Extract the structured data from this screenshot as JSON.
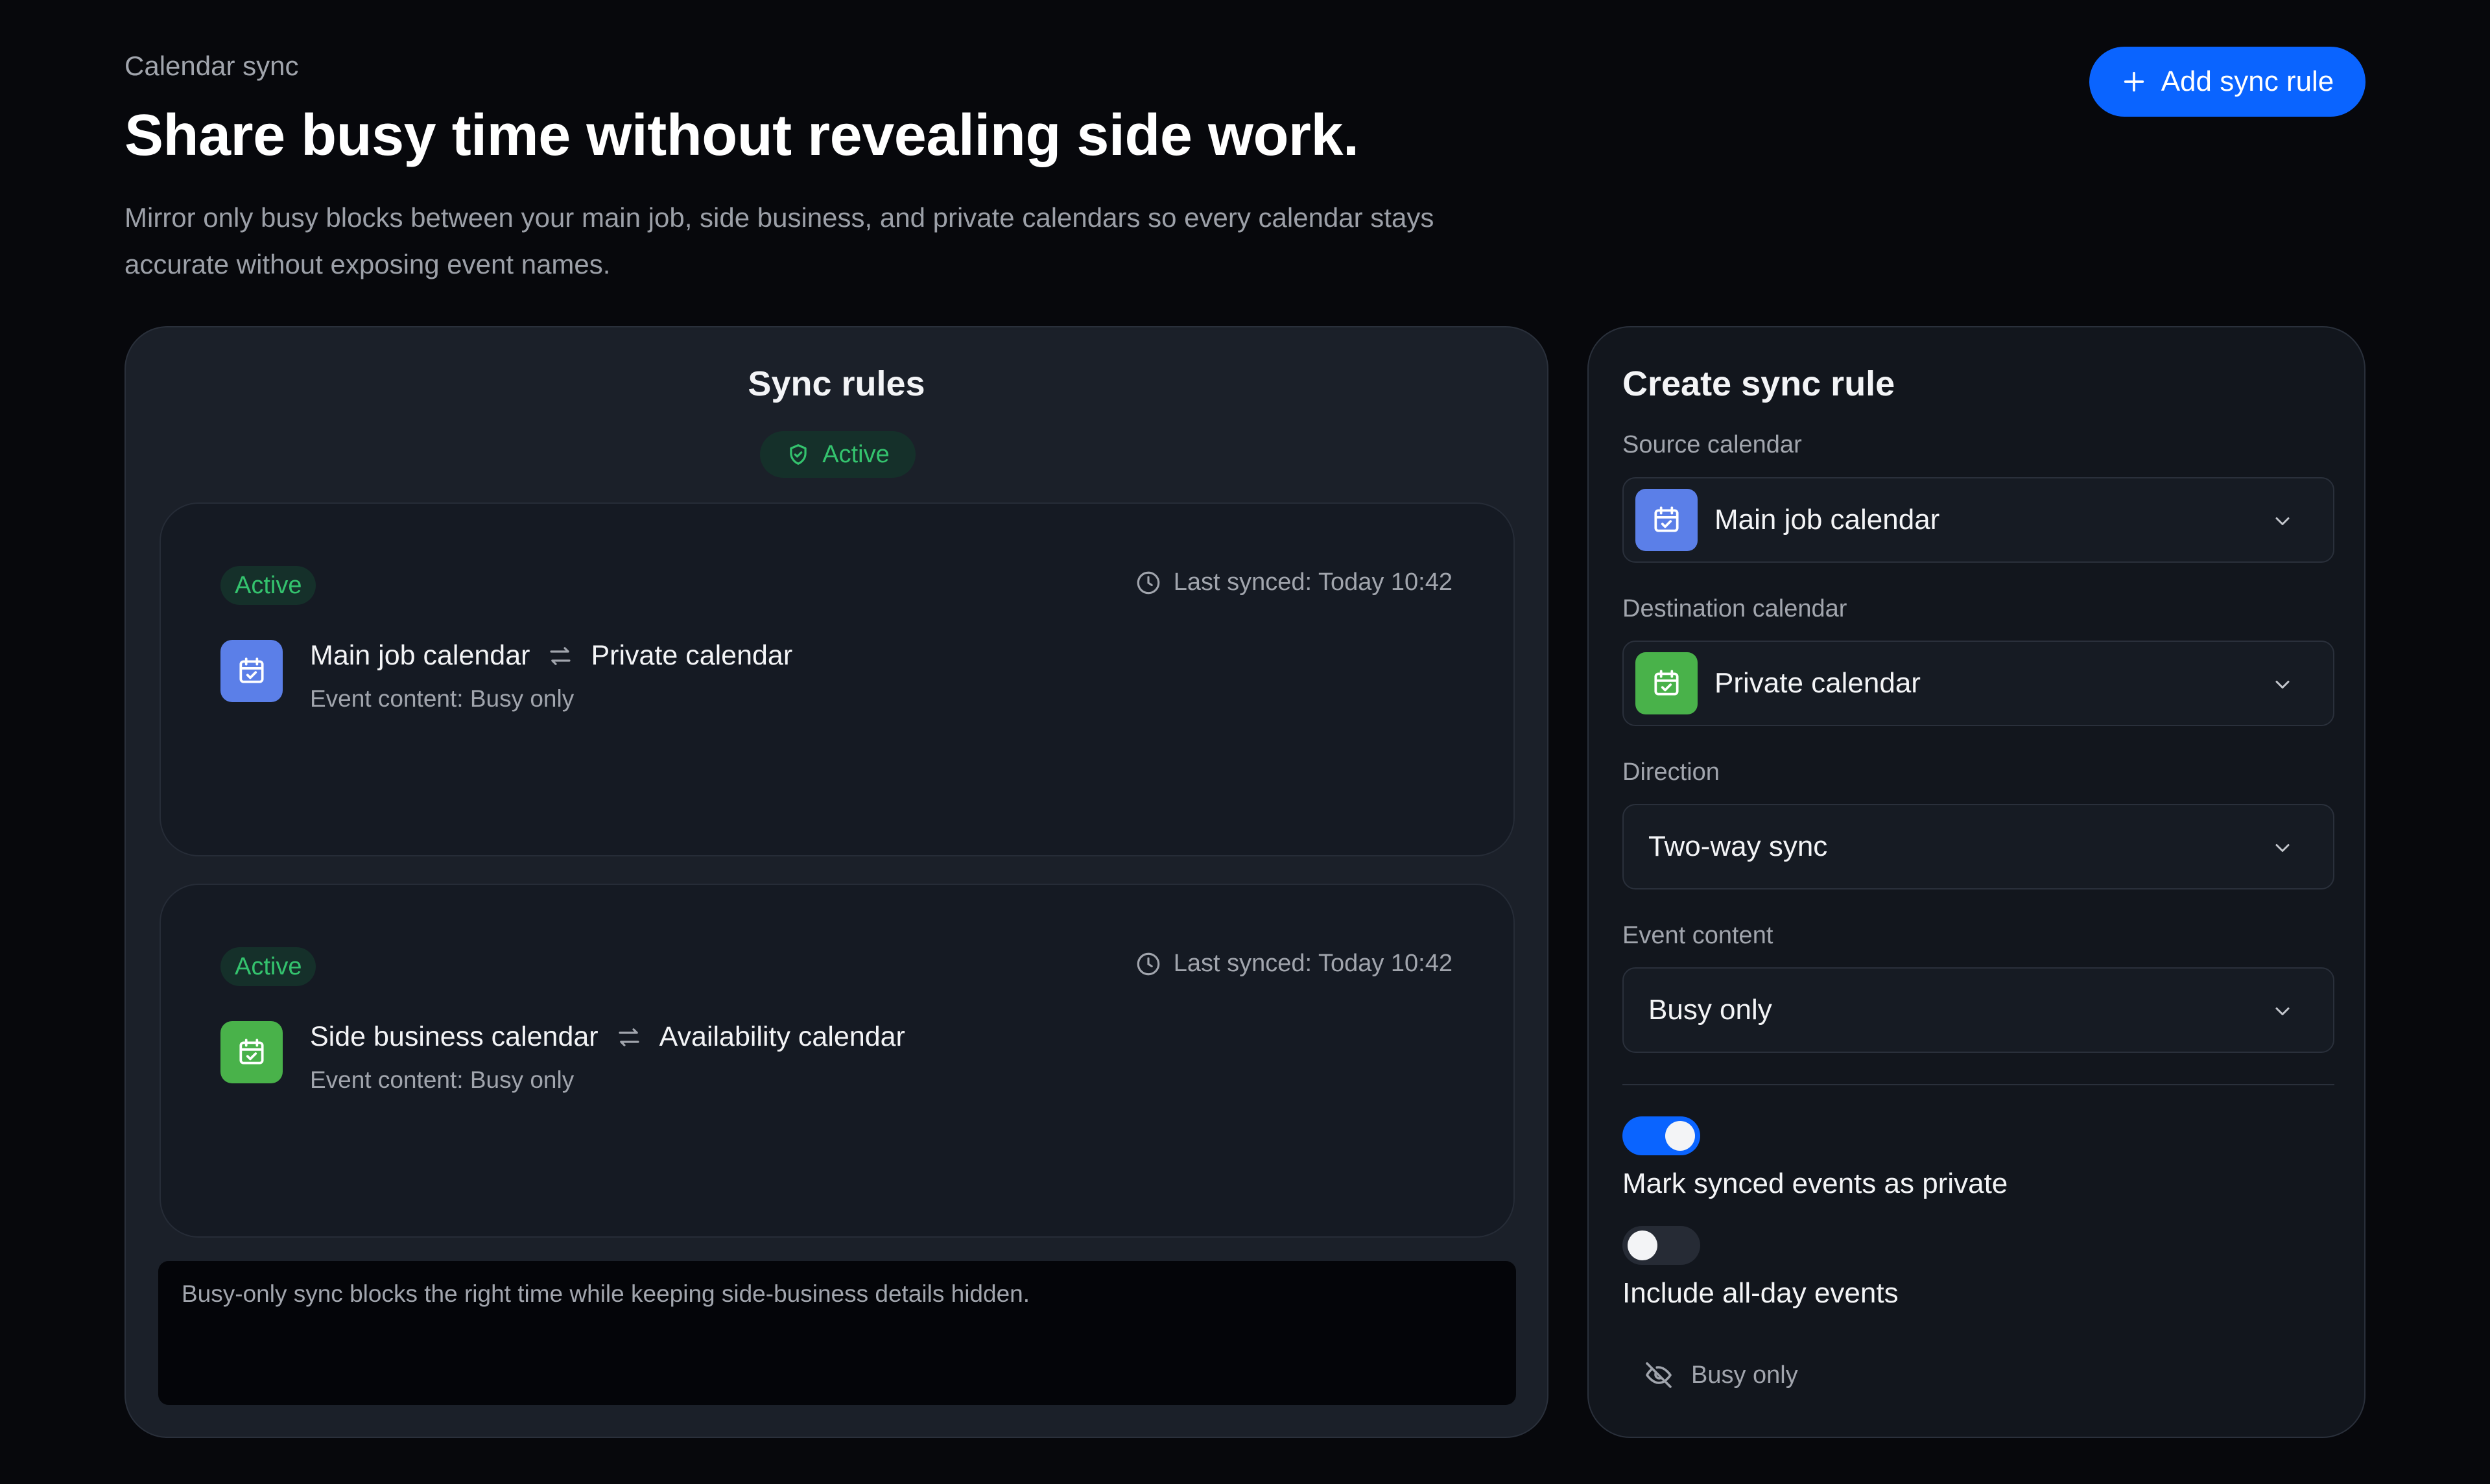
{
  "header": {
    "eyebrow": "Calendar sync",
    "title": "Share busy time without revealing side work.",
    "subtitle": "Mirror only busy blocks between your main job, side business, and private calendars so every calendar stays accurate without exposing event names.",
    "add_button_label": "Add sync rule"
  },
  "colors": {
    "accent": "#0a64ff",
    "active_green": "#34c36e",
    "main_job_calendar": "#5b7fe8",
    "private_calendar": "#49b24a"
  },
  "sync_rules": {
    "title": "Sync rules",
    "status_badge": "Active",
    "rules": [
      {
        "status": "Active",
        "last_synced": "Last synced: Today 10:42",
        "source": "Main job calendar",
        "destination": "Private calendar",
        "content": "Event content: Busy only",
        "icon": "calendar-check-icon"
      },
      {
        "status": "Active",
        "last_synced": "Last synced: Today 10:42",
        "source": "Side business calendar",
        "destination": "Availability calendar",
        "content": "Event content: Busy only",
        "icon": "calendar-check-icon"
      }
    ],
    "note": "Busy-only sync blocks the right time while keeping side-business details hidden."
  },
  "create_rule": {
    "title": "Create sync rule",
    "source_label": "Source calendar",
    "source_value": "Main job calendar",
    "destination_label": "Destination calendar",
    "destination_value": "Private calendar",
    "direction_label": "Direction",
    "direction_value": "Two-way sync",
    "content_label": "Event content",
    "content_value": "Busy only",
    "toggles": [
      {
        "label": "Mark synced events as private",
        "on": true
      },
      {
        "label": "Include all-day events",
        "on": false
      }
    ],
    "footer_chip": "Busy only"
  }
}
